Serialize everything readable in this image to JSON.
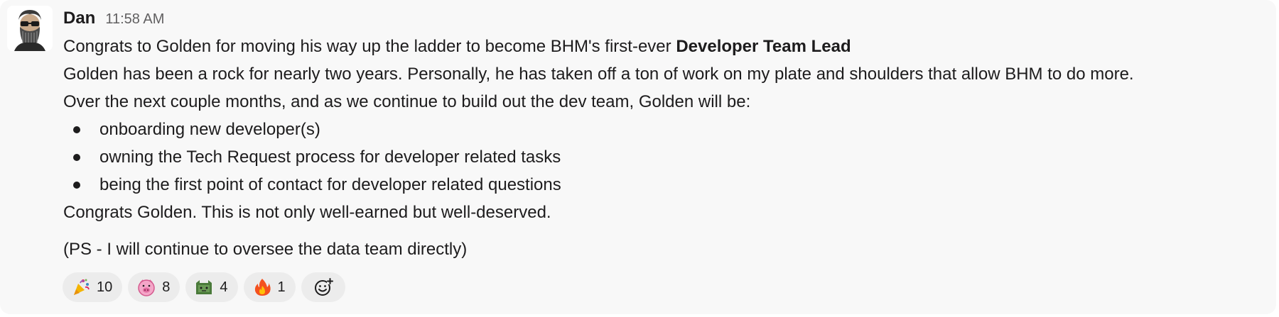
{
  "message": {
    "author": "Dan",
    "timestamp": "11:58 AM",
    "line1_prefix": "Congrats to Golden for moving his way up the ladder to become BHM's first-ever ",
    "line1_bold": "Developer Team Lead",
    "line2": "Golden has been a rock for nearly two years. Personally, he has taken off a ton of work on my plate and shoulders that allow BHM to do more.",
    "line3": "Over the next couple months, and as we continue to build out the dev team, Golden will be:",
    "bullets": [
      "onboarding new developer(s)",
      "owning the Tech Request process for developer related tasks",
      "being the first point of contact for developer related questions"
    ],
    "line4": "Congrats Golden. This is not only well-earned but well-deserved.",
    "line5": "(PS - I will continue to oversee the data team directly)"
  },
  "reactions": [
    {
      "icon": "party-popper-icon",
      "count": "10"
    },
    {
      "icon": "pig-face-icon",
      "count": "8"
    },
    {
      "icon": "green-emoji-icon",
      "count": "4"
    },
    {
      "icon": "fire-icon",
      "count": "1"
    }
  ],
  "colors": {
    "background": "#f8f8f8",
    "text": "#1d1c1d",
    "timestamp": "#616061",
    "reaction_pill": "#ececec"
  }
}
